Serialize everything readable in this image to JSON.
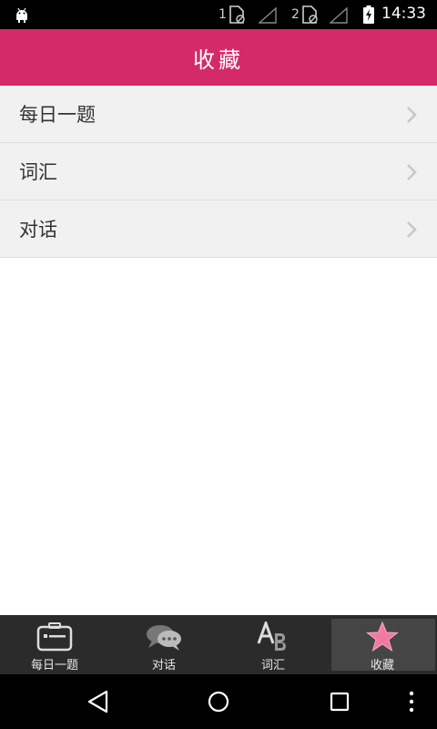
{
  "status_bar": {
    "sim1_label": "1",
    "sim2_label": "2",
    "time": "14:33"
  },
  "header": {
    "title": "收藏"
  },
  "list": {
    "items": [
      {
        "label": "每日一题"
      },
      {
        "label": "词汇"
      },
      {
        "label": "对话"
      }
    ]
  },
  "tabs": [
    {
      "label": "每日一题",
      "icon": "card-icon",
      "active": false
    },
    {
      "label": "对话",
      "icon": "chat-bubbles-icon",
      "active": false
    },
    {
      "label": "词汇",
      "icon": "ab-letters-icon",
      "active": false
    },
    {
      "label": "收藏",
      "icon": "star-icon",
      "active": true
    }
  ],
  "colors": {
    "header_bg": "#d42a6a",
    "tab_bar_bg": "#2b2b2b",
    "active_tab_bg": "#454545",
    "star_pink": "#f07aa4"
  }
}
